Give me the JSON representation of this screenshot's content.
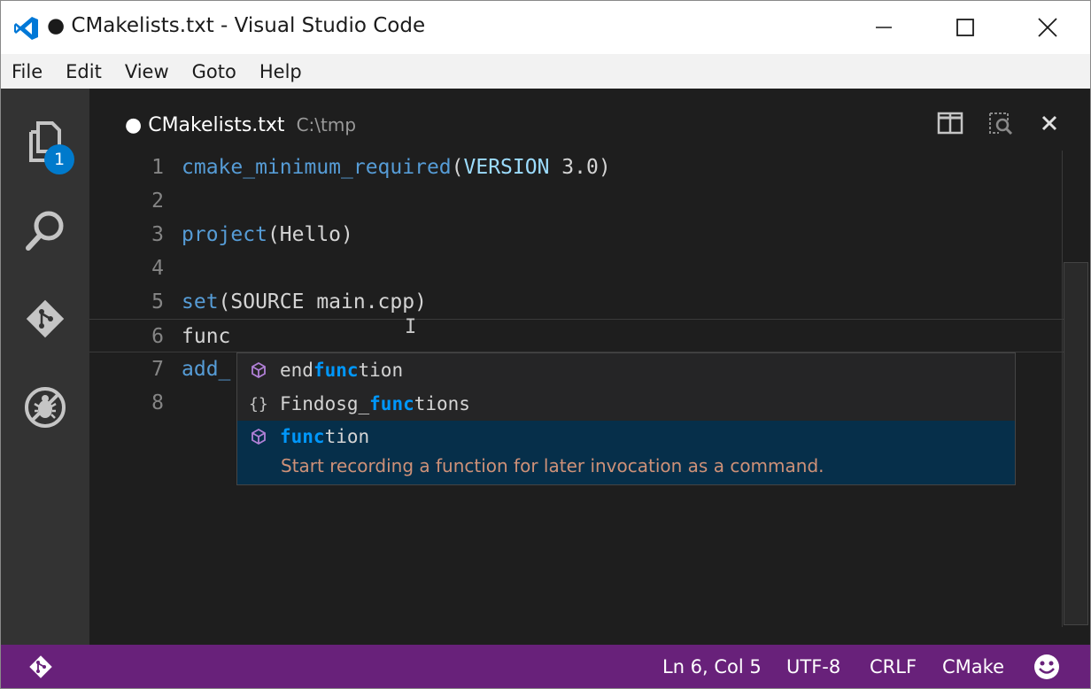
{
  "window": {
    "title": "● CMakelists.txt - Visual Studio Code",
    "icons": {
      "app": "vscode-logo-icon",
      "minimize": "minimize-icon",
      "maximize": "maximize-icon",
      "close": "close-icon"
    }
  },
  "menu": {
    "items": [
      {
        "label": "File"
      },
      {
        "label": "Edit"
      },
      {
        "label": "View"
      },
      {
        "label": "Goto"
      },
      {
        "label": "Help"
      }
    ]
  },
  "activity_bar": {
    "items": [
      {
        "name": "explorer",
        "icon": "files-icon",
        "badge": "1"
      },
      {
        "name": "search",
        "icon": "search-icon"
      },
      {
        "name": "git",
        "icon": "git-icon"
      },
      {
        "name": "debug",
        "icon": "debug-icon"
      }
    ]
  },
  "editor": {
    "tab": {
      "dirty_marker": "●",
      "filename": "CMakelists.txt",
      "path": "C:\\tmp"
    },
    "actions": [
      {
        "name": "split-editor",
        "icon": "split-editor-icon"
      },
      {
        "name": "open-preview",
        "icon": "preview-icon"
      },
      {
        "name": "close-editor",
        "icon": "close-icon"
      }
    ],
    "lines": [
      {
        "number": "1",
        "parts": [
          {
            "t": "cmake_minimum_required",
            "c": "fn"
          },
          {
            "t": "(",
            "c": ""
          },
          {
            "t": "VERSION",
            "c": "kw"
          },
          {
            "t": " 3.0)",
            "c": ""
          }
        ]
      },
      {
        "number": "2",
        "parts": []
      },
      {
        "number": "3",
        "parts": [
          {
            "t": "project",
            "c": "fn"
          },
          {
            "t": "(Hello)",
            "c": ""
          }
        ]
      },
      {
        "number": "4",
        "parts": []
      },
      {
        "number": "5",
        "parts": [
          {
            "t": "set",
            "c": "fn"
          },
          {
            "t": "(SOURCE main.cpp)",
            "c": ""
          }
        ]
      },
      {
        "number": "6",
        "parts": [
          {
            "t": "func",
            "c": ""
          }
        ]
      },
      {
        "number": "7",
        "parts": [
          {
            "t": "add_",
            "c": "fn"
          }
        ]
      },
      {
        "number": "8",
        "parts": []
      }
    ],
    "current_line": 6
  },
  "suggest": {
    "items": [
      {
        "icon": "keyword-cube-icon",
        "prefix": "end",
        "match": "func",
        "suffix": "tion"
      },
      {
        "icon": "snippet-braces-icon",
        "prefix": "Findosg_",
        "match": "func",
        "suffix": "tions"
      },
      {
        "icon": "keyword-cube-icon",
        "prefix": "",
        "match": "func",
        "suffix": "tion",
        "selected": true,
        "doc": "Start recording a function for later invocation as a command."
      }
    ]
  },
  "status_bar": {
    "git_icon": "git-branch-icon",
    "position": "Ln 6, Col 5",
    "encoding": "UTF-8",
    "line_ending": "CRLF",
    "language": "CMake",
    "feedback_icon": "smiley-icon"
  },
  "colors": {
    "status_bar": "#68217a",
    "activity_bar": "#333333",
    "editor_bg": "#1e1e1e",
    "accent": "#007acc",
    "match_highlight": "#0097fb"
  }
}
